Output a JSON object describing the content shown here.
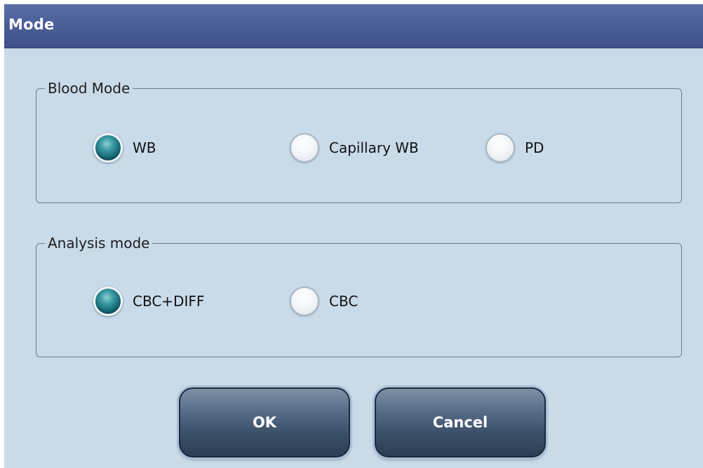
{
  "dialog": {
    "title": "Mode"
  },
  "blood_mode": {
    "legend": "Blood Mode",
    "options": [
      {
        "label": "WB",
        "selected": true
      },
      {
        "label": "Capillary WB",
        "selected": false
      },
      {
        "label": "PD",
        "selected": false
      }
    ]
  },
  "analysis_mode": {
    "legend": "Analysis mode",
    "options": [
      {
        "label": "CBC+DIFF",
        "selected": true
      },
      {
        "label": "CBC",
        "selected": false
      }
    ]
  },
  "buttons": {
    "ok_label": "OK",
    "cancel_label": "Cancel"
  },
  "colors": {
    "titlebar": "#4b5f98",
    "dialog_background": "#c9dae9",
    "radio_selected": "#176a77",
    "button": "#3b5069"
  }
}
